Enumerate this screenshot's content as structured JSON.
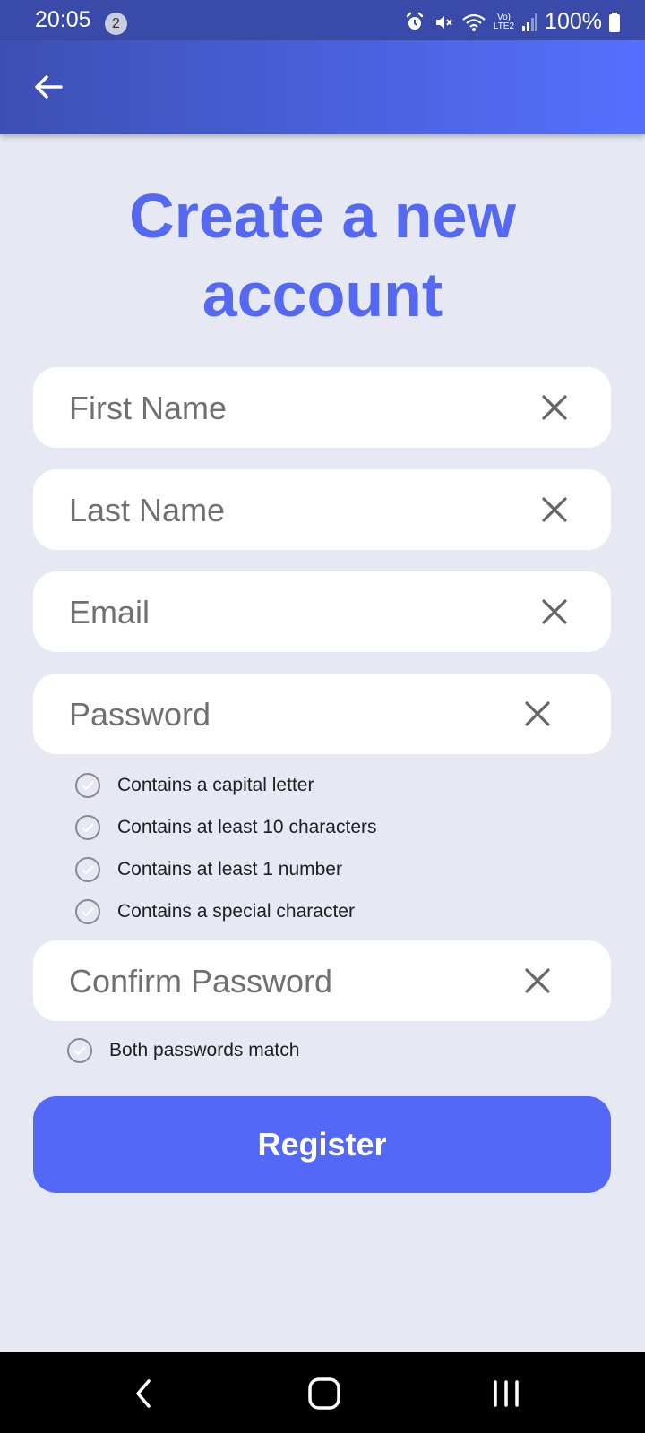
{
  "status_bar": {
    "time": "20:05",
    "notification_count": "2",
    "network_label_top": "Vo)",
    "network_label_bottom": "LTE2",
    "battery": "100%"
  },
  "app_bar": {
    "back_icon": "arrow-left-icon"
  },
  "title": {
    "line1": "Create a new",
    "line2": "account"
  },
  "form": {
    "first_name_placeholder": "First Name",
    "last_name_placeholder": "Last Name",
    "email_placeholder": "Email",
    "password_placeholder": "Password",
    "confirm_password_placeholder": "Confirm Password",
    "password_rules": [
      "Contains a capital letter",
      "Contains at least 10 characters",
      "Contains at least 1 number",
      "Contains a special character"
    ],
    "confirm_rule": "Both passwords match",
    "register_label": "Register"
  },
  "colors": {
    "accent": "#5468f7",
    "app_bar_start": "#3d4fb4",
    "app_bar_end": "#5570ff",
    "background": "#e6e8f4"
  }
}
